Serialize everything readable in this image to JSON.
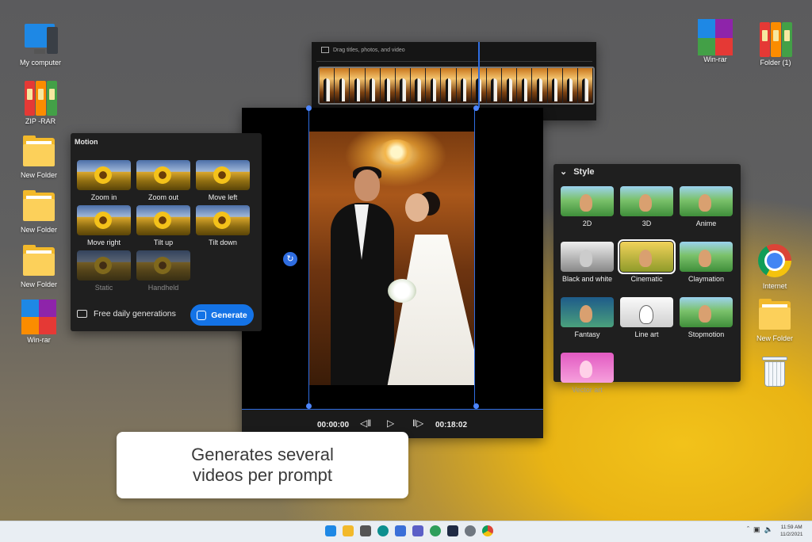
{
  "desktop_left": [
    {
      "name": "my-computer",
      "label": "My computer"
    },
    {
      "name": "zip-rar",
      "label": "ZIP -RAR"
    },
    {
      "name": "new-folder-1",
      "label": "New Folder"
    },
    {
      "name": "new-folder-2",
      "label": "New Folder"
    },
    {
      "name": "new-folder-3",
      "label": "New Folder"
    },
    {
      "name": "win-rar-left",
      "label": "Win-rar"
    }
  ],
  "desktop_right": {
    "winrar": "Win-rar",
    "folder1": "Folder (1)",
    "internet": "Internet",
    "new_folder": "New Folder"
  },
  "motion": {
    "title": "Motion",
    "items": [
      "Zoom in",
      "Zoom out",
      "Move left",
      "Move right",
      "Tilt up",
      "Tilt down",
      "Static",
      "Handheld"
    ],
    "free_label": "Free daily generations",
    "generate_label": "Generate"
  },
  "timeline": {
    "drag_hint": "Drag titles, photos, and video"
  },
  "player": {
    "current_time": "00:00:00",
    "total_time": "00:18:02"
  },
  "style": {
    "title": "Style",
    "items": [
      "2D",
      "3D",
      "Anime",
      "Black and white",
      "Cinematic",
      "Claymation",
      "Fantasy",
      "Line art",
      "Stopmotion",
      "Vector art"
    ],
    "selected": "Cinematic"
  },
  "caption": {
    "line1": "Generates several",
    "line2": "videos per prompt"
  },
  "taskbar": {
    "time": "11:59 AM",
    "date": "11/2/2021"
  },
  "colors": {
    "accent": "#1473e6",
    "selection": "#2f6de1"
  }
}
